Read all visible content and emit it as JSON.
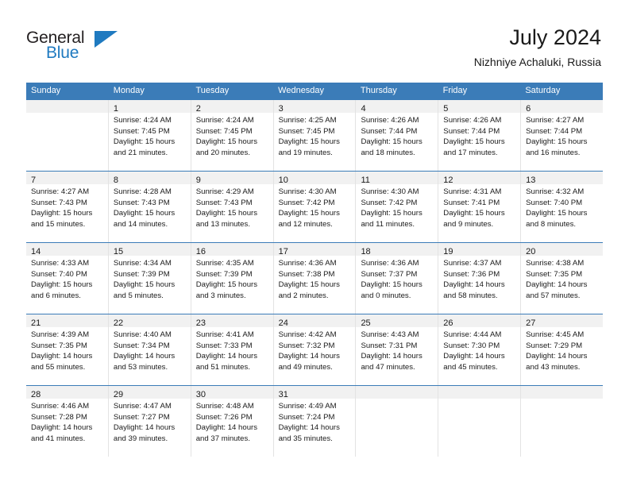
{
  "brand": {
    "word_one": "General",
    "word_two": "Blue",
    "icon": "triangle-logo",
    "color_primary": "#1f7ac0",
    "color_text": "#231f20"
  },
  "header": {
    "title": "July 2024",
    "subtitle": "Nizhniye Achaluki, Russia"
  },
  "theme": {
    "header_blue": "#3b7cb8",
    "daynum_band": "#f1f1f1",
    "cell_border": "#e3e3e3"
  },
  "weekdays": [
    "Sunday",
    "Monday",
    "Tuesday",
    "Wednesday",
    "Thursday",
    "Friday",
    "Saturday"
  ],
  "weeks": [
    [
      {
        "day": "",
        "sunrise": "",
        "sunset": "",
        "daylight_line1": "",
        "daylight_line2": ""
      },
      {
        "day": "1",
        "sunrise": "Sunrise: 4:24 AM",
        "sunset": "Sunset: 7:45 PM",
        "daylight_line1": "Daylight: 15 hours",
        "daylight_line2": "and 21 minutes."
      },
      {
        "day": "2",
        "sunrise": "Sunrise: 4:24 AM",
        "sunset": "Sunset: 7:45 PM",
        "daylight_line1": "Daylight: 15 hours",
        "daylight_line2": "and 20 minutes."
      },
      {
        "day": "3",
        "sunrise": "Sunrise: 4:25 AM",
        "sunset": "Sunset: 7:45 PM",
        "daylight_line1": "Daylight: 15 hours",
        "daylight_line2": "and 19 minutes."
      },
      {
        "day": "4",
        "sunrise": "Sunrise: 4:26 AM",
        "sunset": "Sunset: 7:44 PM",
        "daylight_line1": "Daylight: 15 hours",
        "daylight_line2": "and 18 minutes."
      },
      {
        "day": "5",
        "sunrise": "Sunrise: 4:26 AM",
        "sunset": "Sunset: 7:44 PM",
        "daylight_line1": "Daylight: 15 hours",
        "daylight_line2": "and 17 minutes."
      },
      {
        "day": "6",
        "sunrise": "Sunrise: 4:27 AM",
        "sunset": "Sunset: 7:44 PM",
        "daylight_line1": "Daylight: 15 hours",
        "daylight_line2": "and 16 minutes."
      }
    ],
    [
      {
        "day": "7",
        "sunrise": "Sunrise: 4:27 AM",
        "sunset": "Sunset: 7:43 PM",
        "daylight_line1": "Daylight: 15 hours",
        "daylight_line2": "and 15 minutes."
      },
      {
        "day": "8",
        "sunrise": "Sunrise: 4:28 AM",
        "sunset": "Sunset: 7:43 PM",
        "daylight_line1": "Daylight: 15 hours",
        "daylight_line2": "and 14 minutes."
      },
      {
        "day": "9",
        "sunrise": "Sunrise: 4:29 AM",
        "sunset": "Sunset: 7:43 PM",
        "daylight_line1": "Daylight: 15 hours",
        "daylight_line2": "and 13 minutes."
      },
      {
        "day": "10",
        "sunrise": "Sunrise: 4:30 AM",
        "sunset": "Sunset: 7:42 PM",
        "daylight_line1": "Daylight: 15 hours",
        "daylight_line2": "and 12 minutes."
      },
      {
        "day": "11",
        "sunrise": "Sunrise: 4:30 AM",
        "sunset": "Sunset: 7:42 PM",
        "daylight_line1": "Daylight: 15 hours",
        "daylight_line2": "and 11 minutes."
      },
      {
        "day": "12",
        "sunrise": "Sunrise: 4:31 AM",
        "sunset": "Sunset: 7:41 PM",
        "daylight_line1": "Daylight: 15 hours",
        "daylight_line2": "and 9 minutes."
      },
      {
        "day": "13",
        "sunrise": "Sunrise: 4:32 AM",
        "sunset": "Sunset: 7:40 PM",
        "daylight_line1": "Daylight: 15 hours",
        "daylight_line2": "and 8 minutes."
      }
    ],
    [
      {
        "day": "14",
        "sunrise": "Sunrise: 4:33 AM",
        "sunset": "Sunset: 7:40 PM",
        "daylight_line1": "Daylight: 15 hours",
        "daylight_line2": "and 6 minutes."
      },
      {
        "day": "15",
        "sunrise": "Sunrise: 4:34 AM",
        "sunset": "Sunset: 7:39 PM",
        "daylight_line1": "Daylight: 15 hours",
        "daylight_line2": "and 5 minutes."
      },
      {
        "day": "16",
        "sunrise": "Sunrise: 4:35 AM",
        "sunset": "Sunset: 7:39 PM",
        "daylight_line1": "Daylight: 15 hours",
        "daylight_line2": "and 3 minutes."
      },
      {
        "day": "17",
        "sunrise": "Sunrise: 4:36 AM",
        "sunset": "Sunset: 7:38 PM",
        "daylight_line1": "Daylight: 15 hours",
        "daylight_line2": "and 2 minutes."
      },
      {
        "day": "18",
        "sunrise": "Sunrise: 4:36 AM",
        "sunset": "Sunset: 7:37 PM",
        "daylight_line1": "Daylight: 15 hours",
        "daylight_line2": "and 0 minutes."
      },
      {
        "day": "19",
        "sunrise": "Sunrise: 4:37 AM",
        "sunset": "Sunset: 7:36 PM",
        "daylight_line1": "Daylight: 14 hours",
        "daylight_line2": "and 58 minutes."
      },
      {
        "day": "20",
        "sunrise": "Sunrise: 4:38 AM",
        "sunset": "Sunset: 7:35 PM",
        "daylight_line1": "Daylight: 14 hours",
        "daylight_line2": "and 57 minutes."
      }
    ],
    [
      {
        "day": "21",
        "sunrise": "Sunrise: 4:39 AM",
        "sunset": "Sunset: 7:35 PM",
        "daylight_line1": "Daylight: 14 hours",
        "daylight_line2": "and 55 minutes."
      },
      {
        "day": "22",
        "sunrise": "Sunrise: 4:40 AM",
        "sunset": "Sunset: 7:34 PM",
        "daylight_line1": "Daylight: 14 hours",
        "daylight_line2": "and 53 minutes."
      },
      {
        "day": "23",
        "sunrise": "Sunrise: 4:41 AM",
        "sunset": "Sunset: 7:33 PM",
        "daylight_line1": "Daylight: 14 hours",
        "daylight_line2": "and 51 minutes."
      },
      {
        "day": "24",
        "sunrise": "Sunrise: 4:42 AM",
        "sunset": "Sunset: 7:32 PM",
        "daylight_line1": "Daylight: 14 hours",
        "daylight_line2": "and 49 minutes."
      },
      {
        "day": "25",
        "sunrise": "Sunrise: 4:43 AM",
        "sunset": "Sunset: 7:31 PM",
        "daylight_line1": "Daylight: 14 hours",
        "daylight_line2": "and 47 minutes."
      },
      {
        "day": "26",
        "sunrise": "Sunrise: 4:44 AM",
        "sunset": "Sunset: 7:30 PM",
        "daylight_line1": "Daylight: 14 hours",
        "daylight_line2": "and 45 minutes."
      },
      {
        "day": "27",
        "sunrise": "Sunrise: 4:45 AM",
        "sunset": "Sunset: 7:29 PM",
        "daylight_line1": "Daylight: 14 hours",
        "daylight_line2": "and 43 minutes."
      }
    ],
    [
      {
        "day": "28",
        "sunrise": "Sunrise: 4:46 AM",
        "sunset": "Sunset: 7:28 PM",
        "daylight_line1": "Daylight: 14 hours",
        "daylight_line2": "and 41 minutes."
      },
      {
        "day": "29",
        "sunrise": "Sunrise: 4:47 AM",
        "sunset": "Sunset: 7:27 PM",
        "daylight_line1": "Daylight: 14 hours",
        "daylight_line2": "and 39 minutes."
      },
      {
        "day": "30",
        "sunrise": "Sunrise: 4:48 AM",
        "sunset": "Sunset: 7:26 PM",
        "daylight_line1": "Daylight: 14 hours",
        "daylight_line2": "and 37 minutes."
      },
      {
        "day": "31",
        "sunrise": "Sunrise: 4:49 AM",
        "sunset": "Sunset: 7:24 PM",
        "daylight_line1": "Daylight: 14 hours",
        "daylight_line2": "and 35 minutes."
      },
      {
        "day": "",
        "sunrise": "",
        "sunset": "",
        "daylight_line1": "",
        "daylight_line2": ""
      },
      {
        "day": "",
        "sunrise": "",
        "sunset": "",
        "daylight_line1": "",
        "daylight_line2": ""
      },
      {
        "day": "",
        "sunrise": "",
        "sunset": "",
        "daylight_line1": "",
        "daylight_line2": ""
      }
    ]
  ]
}
